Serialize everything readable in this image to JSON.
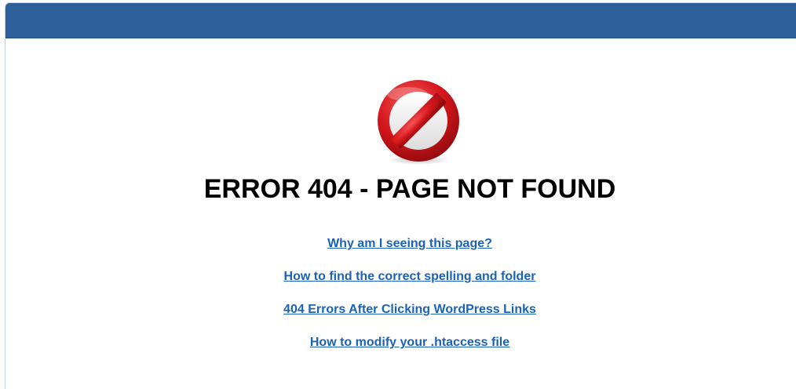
{
  "header": {
    "bar_color": "#2d6099"
  },
  "error": {
    "icon": "prohibited-icon",
    "title": "ERROR 404 - PAGE NOT FOUND"
  },
  "links": [
    {
      "label": "Why am I seeing this page?"
    },
    {
      "label": "How to find the correct spelling and folder"
    },
    {
      "label": "404 Errors After Clicking WordPress Links"
    },
    {
      "label": "How to modify your .htaccess file"
    }
  ],
  "colors": {
    "link": "#1a62b8",
    "title": "#000000",
    "icon_red": "#d4161b"
  }
}
